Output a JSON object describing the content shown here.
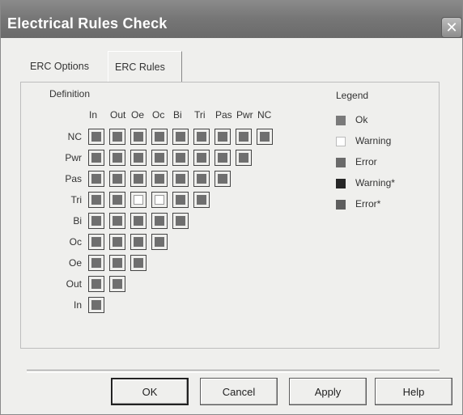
{
  "window": {
    "title": "Electrical Rules Check",
    "close_glyph": "✕"
  },
  "tabs": [
    {
      "label": "ERC Options",
      "active": false
    },
    {
      "label": "ERC Rules",
      "active": true
    }
  ],
  "matrix": {
    "section_label": "Definition",
    "columns": [
      "In",
      "Out",
      "Oe",
      "Oc",
      "Bi",
      "Tri",
      "Pas",
      "Pwr",
      "NC"
    ],
    "rows": [
      "NC",
      "Pwr",
      "Pas",
      "Tri",
      "Bi",
      "Oc",
      "Oe",
      "Out",
      "In"
    ],
    "cell_states": [
      [
        "error",
        "error",
        "error",
        "error",
        "error",
        "error",
        "error",
        "error",
        "error"
      ],
      [
        "error",
        "error",
        "error",
        "error",
        "error",
        "error",
        "error",
        "error"
      ],
      [
        "error",
        "error",
        "error",
        "error",
        "error",
        "error",
        "error"
      ],
      [
        "error",
        "error",
        "warning",
        "warning",
        "error",
        "error"
      ],
      [
        "error",
        "error",
        "error",
        "error",
        "error"
      ],
      [
        "error",
        "error",
        "error",
        "error"
      ],
      [
        "error",
        "error",
        "error"
      ],
      [
        "error",
        "error"
      ],
      [
        "error"
      ]
    ]
  },
  "legend": {
    "label": "Legend",
    "items": [
      {
        "label": "Ok",
        "color": "#7a7a7a"
      },
      {
        "label": "Warning",
        "color": "#ffffff"
      },
      {
        "label": "Error",
        "color": "#6a6a6a"
      },
      {
        "label": "Warning*",
        "color": "#262626"
      },
      {
        "label": "Error*",
        "color": "#5e5e5e"
      }
    ]
  },
  "buttons": {
    "ok": "OK",
    "cancel": "Cancel",
    "apply": "Apply",
    "help": "Help"
  }
}
